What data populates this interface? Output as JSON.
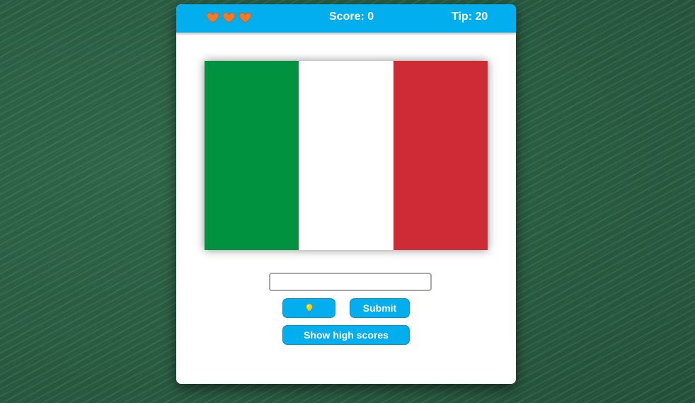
{
  "header": {
    "lives": 3,
    "score_label": "Score: 0",
    "tip_label": "Tip: 20"
  },
  "flag": {
    "stripes": [
      "#00923f",
      "#ffffff",
      "#ce2b37"
    ]
  },
  "answer": {
    "value": "",
    "placeholder": ""
  },
  "buttons": {
    "hint_icon": "lightbulb-icon",
    "submit_label": "Submit",
    "highscores_label": "Show high scores"
  },
  "colors": {
    "accent": "#03aeef",
    "heart": "#f07a2a",
    "board": "#2a5a40"
  }
}
